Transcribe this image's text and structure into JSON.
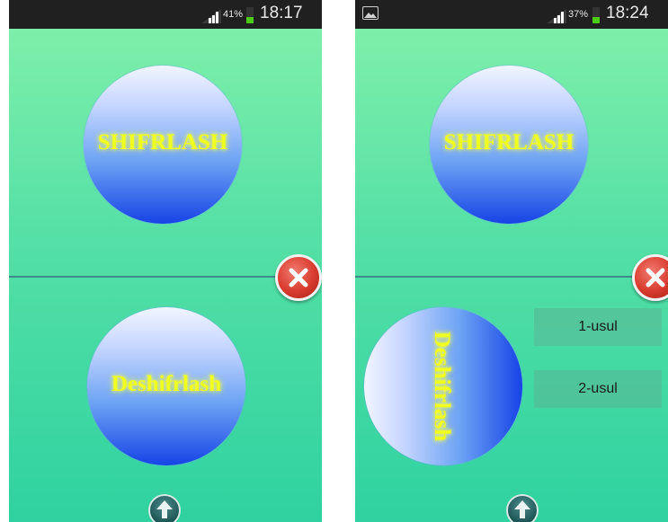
{
  "screens": [
    {
      "status": {
        "battery_pct": "41%",
        "battery_level": 0.41,
        "time": "18:17"
      },
      "encrypt_label": "SHIFRLASH",
      "decrypt_label": "Deshifrlash"
    },
    {
      "status": {
        "battery_pct": "37%",
        "battery_level": 0.37,
        "time": "18:24",
        "notification_icon": "gallery-icon"
      },
      "encrypt_label": "SHIFRLASH",
      "decrypt_label": "Deshifrlash",
      "options": [
        "1-usul",
        "2-usul"
      ]
    }
  ],
  "icons": {
    "close": "close-icon",
    "up": "arrow-up-icon",
    "signal": "signal-icon",
    "battery": "battery-icon"
  },
  "colors": {
    "label_yellow": "#f0ff1c",
    "close_red": "#d83b2e",
    "battery_green": "#4ccc14"
  }
}
